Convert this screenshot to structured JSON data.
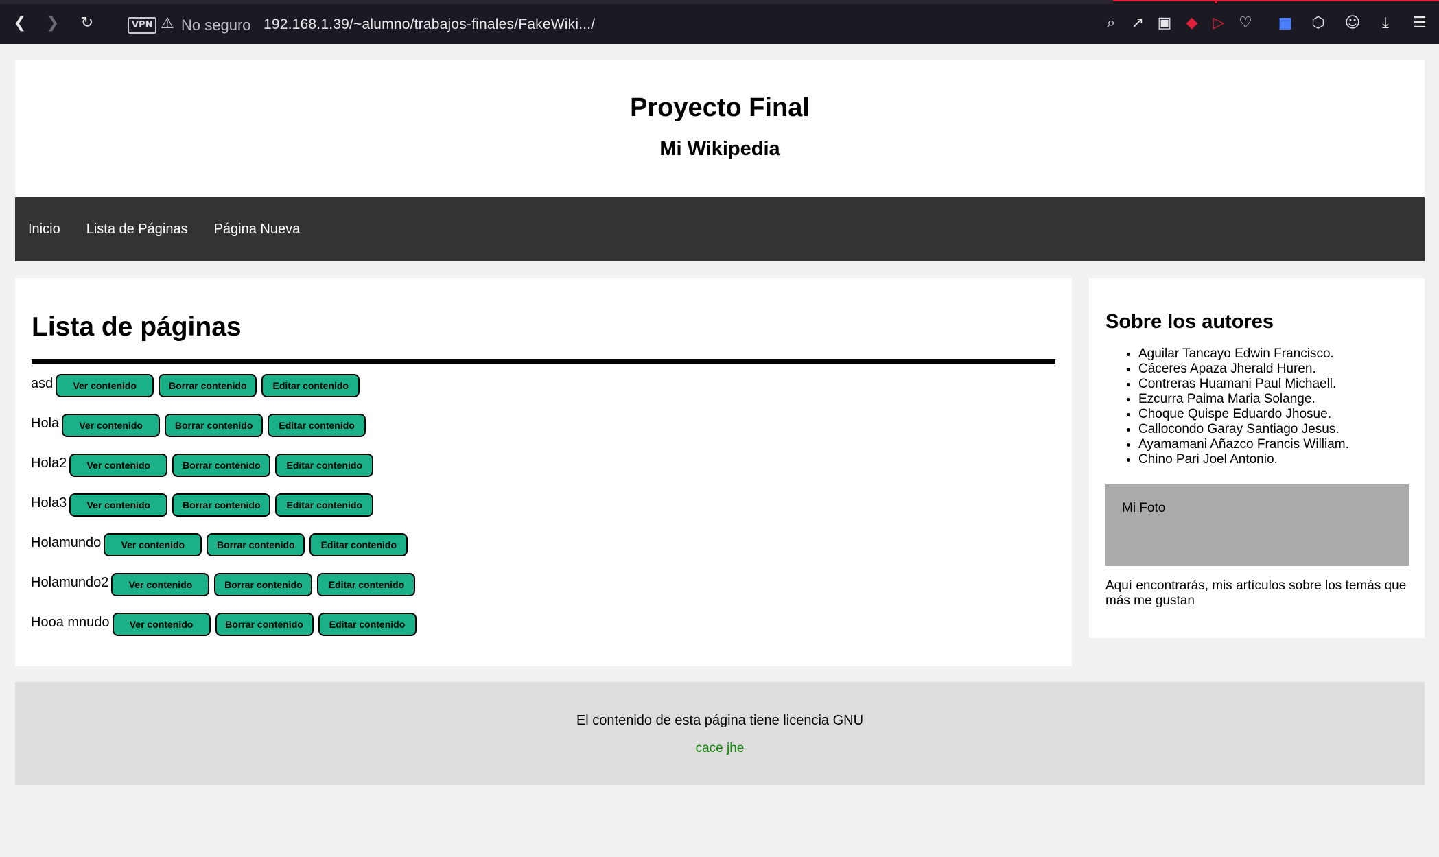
{
  "browser": {
    "vpn_label": "VPN",
    "security_label": "No seguro",
    "url": "192.168.1.39/~alumno/trabajos-finales/FakeWiki.../"
  },
  "header": {
    "title": "Proyecto Final",
    "subtitle": "Mi Wikipedia"
  },
  "nav": {
    "items": [
      "Inicio",
      "Lista de Páginas",
      "Página Nueva"
    ]
  },
  "main": {
    "heading": "Lista de páginas",
    "buttons": {
      "view": "Ver contenido",
      "delete": "Borrar contenido",
      "edit": "Editar contenido"
    },
    "pages": [
      "asd",
      "Hola",
      "Hola2",
      "Hola3",
      "Holamundo",
      "Holamundo2",
      "Hooa mnudo"
    ]
  },
  "sidebar": {
    "heading": "Sobre los autores",
    "authors": [
      "Aguilar Tancayo Edwin Francisco.",
      "Cáceres Apaza Jherald Huren.",
      "Contreras Huamani Paul Michaell.",
      "Ezcurra Paima Maria Solange.",
      "Choque Quispe Eduardo Jhosue.",
      "Callocondo Garay Santiago Jesus.",
      "Ayamamani Añazco Francis William.",
      "Chino Pari Joel Antonio."
    ],
    "photo_label": "Mi Foto",
    "about": "Aquí encontrarás, mis artículos sobre los temás que más me gustan"
  },
  "footer": {
    "license": "El contenido de esta página tiene licencia GNU",
    "link": "cace jhe"
  },
  "colors": {
    "button_bg": "#1ab188",
    "nav_bg": "#333333",
    "footer_bg": "#dddddd",
    "footer_link": "#138808"
  }
}
